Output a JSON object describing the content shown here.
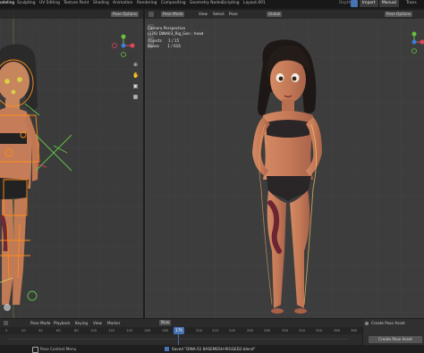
{
  "topbar": {
    "tabs": [
      "odeling",
      "Sculpting",
      "UV Editing",
      "Texture Paint",
      "Shading",
      "Animation",
      "Rendering",
      "Compositing",
      "Geometry Nodes",
      "Scripting",
      "Layout.001"
    ],
    "active_tab": "odeling",
    "right_buttons": [
      "Depth",
      "Import",
      "Manual",
      "Trans"
    ]
  },
  "left_viewport": {
    "header_option": "Pose Options"
  },
  "main_viewport": {
    "mode": "Pose Mode",
    "menus": [
      "View",
      "Select",
      "Pose"
    ],
    "orientation": "Global",
    "header_option": "Pose Options",
    "camera_label": "Camera Perspective",
    "object_line": "(176) DINA03_Rig_Gen : head",
    "objects_label": "Objects",
    "objects_value": "1 / 15",
    "bones_label": "Bones",
    "bones_value": "1 / 616"
  },
  "timeline": {
    "controls": [
      "Pose Mode",
      "Playback",
      "Keying",
      "View",
      "Marker"
    ],
    "now_label": "Now",
    "current_frame": "176",
    "ticks": [
      "0",
      "20",
      "40",
      "60",
      "80",
      "100",
      "120",
      "140",
      "160",
      "180",
      "200",
      "220",
      "240",
      "260",
      "280",
      "300",
      "320",
      "340",
      "360",
      "380"
    ],
    "keyframe_label": "Nearest Frame"
  },
  "asset_panel": {
    "create_pose_asset_top": "Create Pose Asset",
    "create_pose_asset_btn": "Create Pose Asset"
  },
  "statusbar": {
    "left_text": "Pose Context Menu",
    "saved_message": "Saved \"DINA-S1 BASEMESH-RIGGED2.blend\""
  },
  "colors": {
    "accent_blue": "#4772b3",
    "selected_orange": "#ff8c1a",
    "axis_red": "#e64556",
    "axis_green": "#68c13e",
    "axis_blue": "#3b7fd9"
  }
}
